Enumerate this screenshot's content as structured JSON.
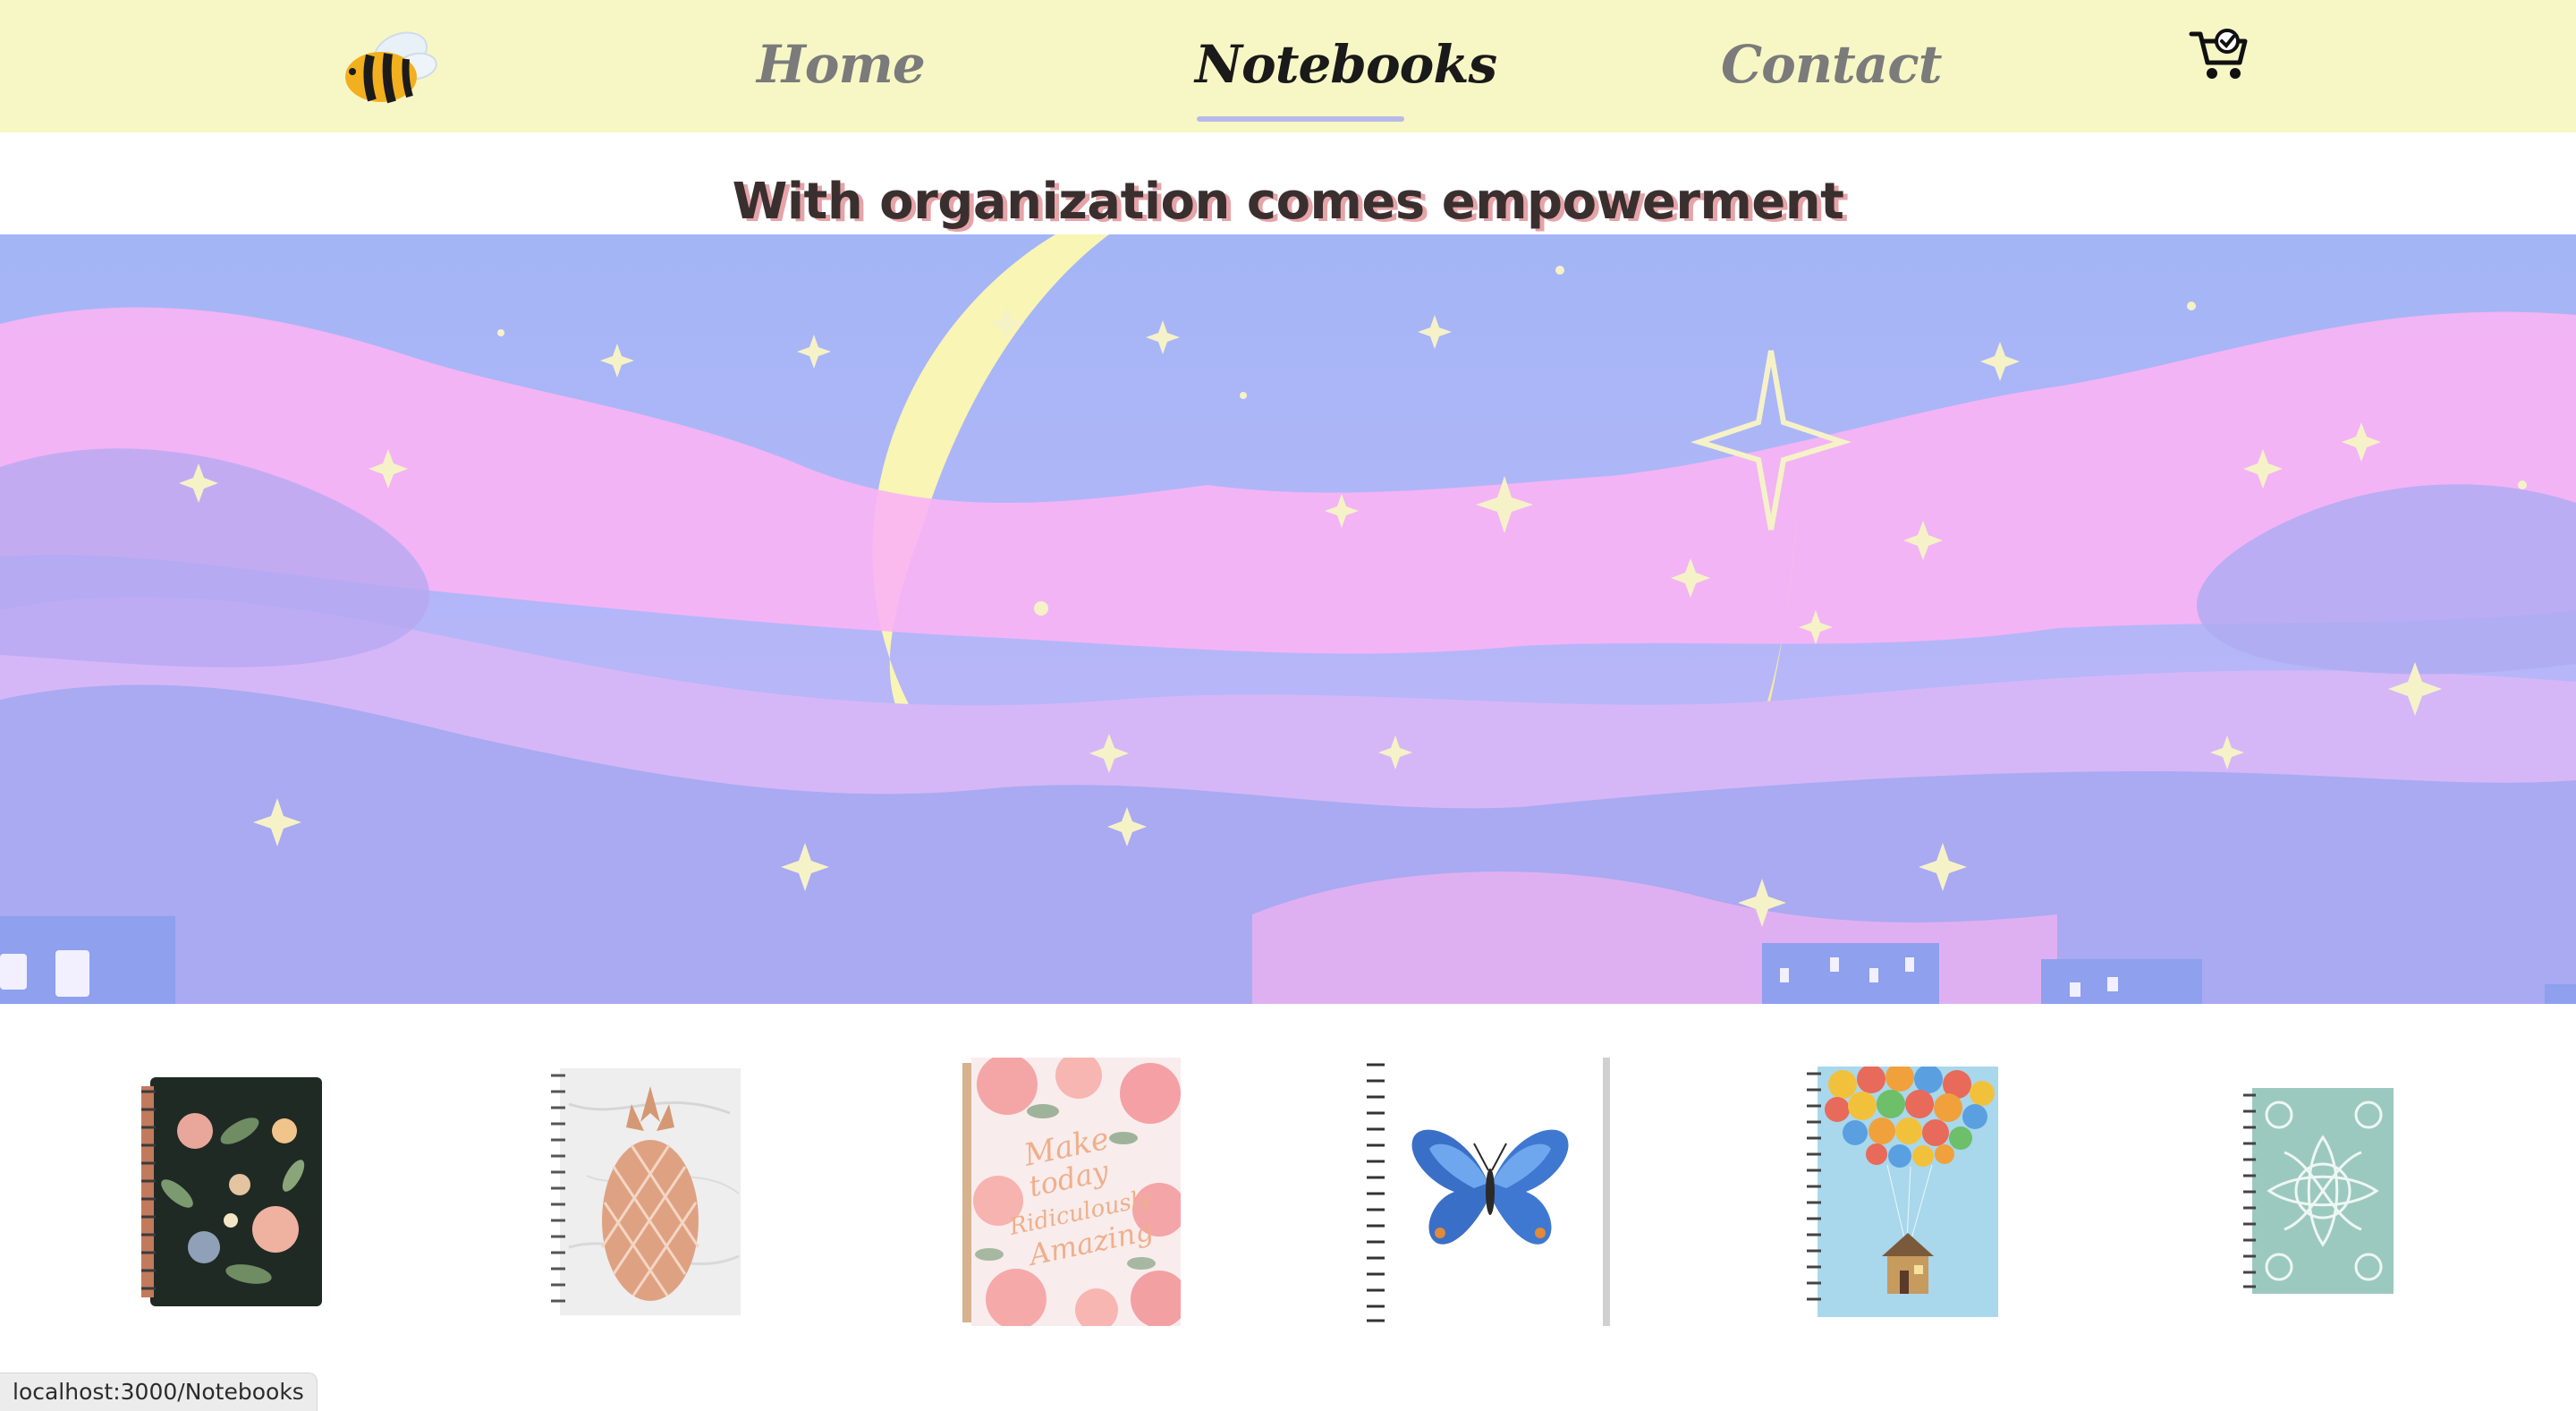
{
  "nav": {
    "logo_icon": "bee-logo-icon",
    "links": [
      {
        "label": "Home",
        "active": false
      },
      {
        "label": "Notebooks",
        "active": true
      },
      {
        "label": "Contact",
        "active": false
      }
    ],
    "cart_icon": "shopping-cart-icon"
  },
  "hero": {
    "tagline": "With organization comes empowerment",
    "image": "pastel-night-sky-crescent-moon-clouds-stars"
  },
  "products": [
    {
      "name": "dark-floral-notebook"
    },
    {
      "name": "marble-pineapple-notebook"
    },
    {
      "name": "pink-peony-make-today-notebook",
      "cover_text": "Make today Ridiculously Amazing"
    },
    {
      "name": "blue-butterfly-notebook"
    },
    {
      "name": "balloon-house-notebook"
    },
    {
      "name": "teal-mandala-notebook"
    }
  ],
  "status": {
    "url": "localhost:3000/Notebooks"
  },
  "colors": {
    "navbar_bg": "#f7f7c6",
    "nav_inactive": "#7b7b7b",
    "nav_active": "#1a1a1a",
    "nav_underline": "#b9b9e9",
    "tagline_shadow": "#e6a3a8"
  }
}
